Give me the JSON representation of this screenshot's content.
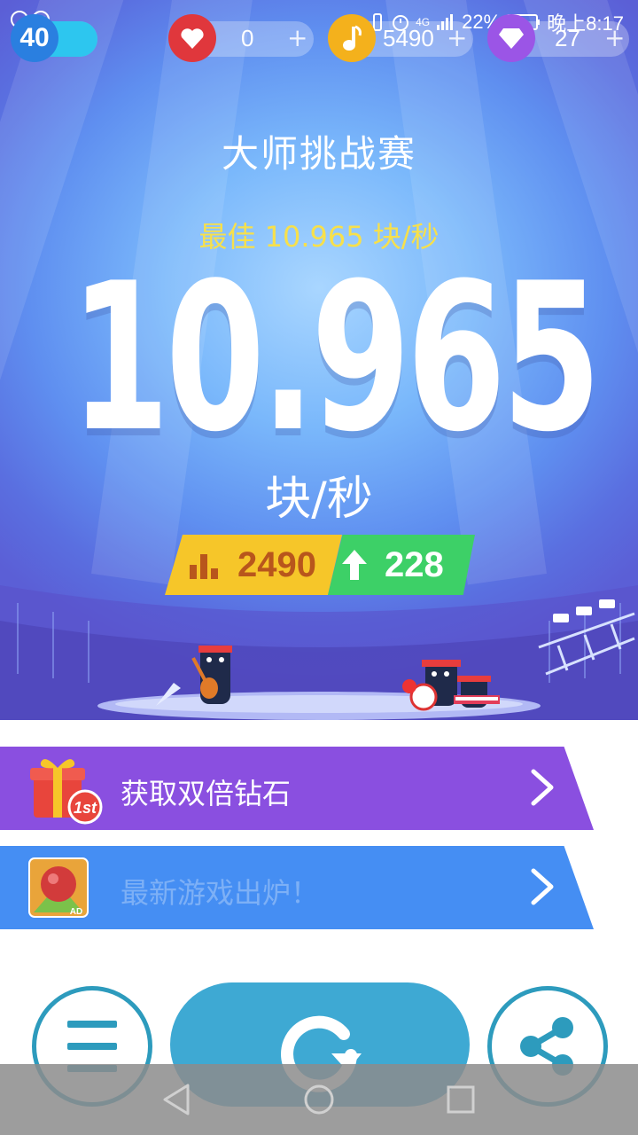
{
  "status_bar": {
    "battery": "22%",
    "network": "4G",
    "time": "晚上8:17"
  },
  "resources": {
    "level": "40",
    "lives": "0",
    "notes": "5490",
    "diamonds": "27",
    "plus": "+"
  },
  "result": {
    "title": "大师挑战赛",
    "best": "最佳 10.965 块/秒",
    "score": "10.965",
    "unit": "块/秒",
    "rank": "2490",
    "rank_up": "228"
  },
  "banners": [
    {
      "label": "获取双倍钻石",
      "badge": "1st",
      "color": "#8a4fe0"
    },
    {
      "label": "最新游戏出炉！",
      "badge": "AD",
      "color": "#458ef3"
    }
  ],
  "colors": {
    "accent": "#3ea9d3",
    "gold": "#f6c629",
    "green": "#3dd067",
    "best_yellow": "#f7e04b"
  }
}
